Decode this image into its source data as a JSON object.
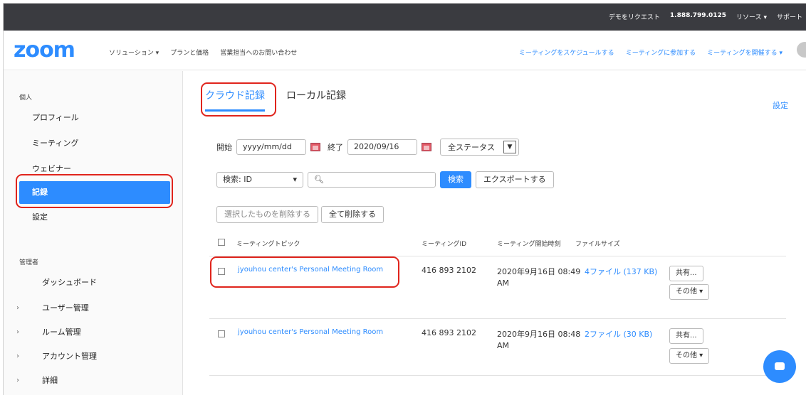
{
  "topbar": {
    "request_demo": "デモをリクエスト",
    "phone": "1.888.799.0125",
    "resources": "リソース ▾",
    "support": "サポート"
  },
  "navbar": {
    "logo": "zoom",
    "solutions": "ソリューション ▾",
    "plans": "プランと価格",
    "contact_sales": "営業担当へのお問い合わせ",
    "schedule": "ミーティングをスケジュールする",
    "join": "ミーティングに参加する",
    "host": "ミーティングを開催する ▾"
  },
  "sidebar": {
    "personal_head": "個人",
    "items": [
      {
        "label": "プロフィール"
      },
      {
        "label": "ミーティング"
      },
      {
        "label": "ウェビナー"
      },
      {
        "label": "記録"
      },
      {
        "label": "設定"
      }
    ],
    "admin_head": "管理者",
    "admin_items": [
      {
        "label": "ダッシュボード"
      },
      {
        "label": "ユーザー管理"
      },
      {
        "label": "ルーム管理"
      },
      {
        "label": "アカウント管理"
      },
      {
        "label": "詳細"
      }
    ]
  },
  "main": {
    "tabs": [
      {
        "label": "クラウド記録"
      },
      {
        "label": "ローカル記録"
      }
    ],
    "settings": "設定",
    "filter": {
      "start_label": "開始",
      "start_placeholder": "yyyy/mm/dd",
      "end_label": "終了",
      "end_value": "2020/09/16",
      "status_value": "全ステータス"
    },
    "search": {
      "type_value": "検索: ID",
      "search_button": "検索",
      "export_button": "エクスポートする"
    },
    "delete": {
      "delete_selected": "選択したものを削除する",
      "delete_all": "全て削除する"
    },
    "table": {
      "headers": [
        "ミーティングトピック",
        "ミーティングID",
        "ミーティング開始時刻",
        "ファイルサイズ"
      ],
      "rows": [
        {
          "topic": "jyouhou center's Personal Meeting Room",
          "id": "416 893 2102",
          "start_line1": "2020年9月16日 08:49",
          "start_line2": "AM",
          "files": "4ファイル (137 KB)",
          "share": "共有...",
          "more": "その他 ▾"
        },
        {
          "topic": "jyouhou center's Personal Meeting Room",
          "id": "416 893 2102",
          "start_line1": "2020年9月16日 08:48",
          "start_line2": "AM",
          "files": "2ファイル (30 KB)",
          "share": "共有...",
          "more": "その他 ▾"
        }
      ]
    }
  },
  "colors": {
    "accent": "#2d8cff",
    "highlight": "#e0241c",
    "topbar": "#3a3b40"
  }
}
